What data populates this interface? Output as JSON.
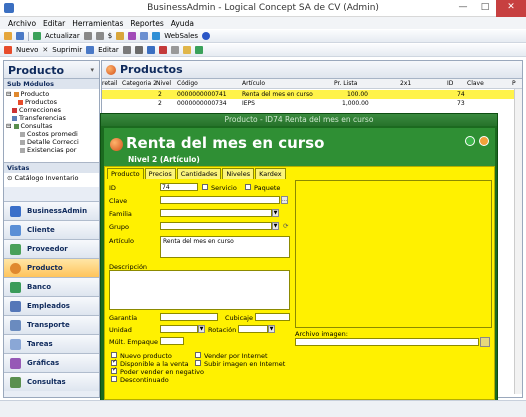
{
  "window": {
    "title": "BusinessAdmin - Logical Concept SA de CV (Admin)"
  },
  "menu": [
    "Archivo",
    "Editar",
    "Herramientas",
    "Reportes",
    "Ayuda"
  ],
  "toolbar1": {
    "refresh": "Actualizar",
    "websales": "WebSales"
  },
  "toolbar2": {
    "new": "Nuevo",
    "delete": "Suprimir",
    "edit": "Editar"
  },
  "sidebar": {
    "title": "Producto",
    "submodules_label": "Sub Módulos",
    "tree": [
      "Producto",
      "Productos",
      "Correcciones",
      "Transferencias",
      "Consultas",
      "Costos promedi",
      "Detalle Correcci",
      "Existencias por"
    ],
    "vistas_label": "Vistas",
    "vistas_item": "Catálogo Inventario",
    "nav": [
      "BusinessAdmin",
      "Cliente",
      "Proveedor",
      "Producto",
      "Banco",
      "Empleados",
      "Transporte",
      "Tareas",
      "Gráficas",
      "Consultas"
    ]
  },
  "main": {
    "title": "Productos",
    "columns": [
      "retail",
      "Categoria 2",
      "Nivel",
      "Código",
      "Artículo",
      "Pr. Lista",
      "2x1",
      "ID",
      "Clave",
      "P"
    ],
    "rows": [
      {
        "nivel": "2",
        "codigo": "0000000000741",
        "articulo": "Renta del mes en curso",
        "precio": "100.00",
        "id": "74"
      },
      {
        "nivel": "2",
        "codigo": "0000000000734",
        "articulo": "IEPS",
        "precio": "1,000.00",
        "id": "73"
      }
    ]
  },
  "detail": {
    "window_title": "Producto - ID74 Renta del mes en curso",
    "heading": "Renta del mes en curso",
    "nivel": "Nivel 2 (Artículo)",
    "tabs": [
      "Producto",
      "Precios",
      "Cantidades",
      "Niveles",
      "Kardex"
    ],
    "labels": {
      "id": "ID",
      "servicio": "Servicio",
      "paquete": "Paquete",
      "clave": "Clave",
      "familia": "Familia",
      "grupo": "Grupo",
      "articulo": "Artículo",
      "descripcion": "Descripción",
      "garantia": "Garantía",
      "cubicaje": "Cubicaje",
      "unidad": "Unidad",
      "rotacion": "Rotación",
      "mult_empaque": "Múlt. Empaque",
      "archivo_imagen": "Archivo imagen:"
    },
    "values": {
      "id": "74",
      "articulo": "Renta del mes en curso"
    },
    "checks": [
      {
        "label": "Nuevo producto",
        "checked": false
      },
      {
        "label": "Disponible a la venta",
        "checked": true
      },
      {
        "label": "Poder vender en negativo",
        "checked": true
      },
      {
        "label": "Descontinuado",
        "checked": false
      },
      {
        "label": "Vender por Internet",
        "checked": false
      },
      {
        "label": "Subir imagen en Internet",
        "checked": false
      }
    ]
  }
}
